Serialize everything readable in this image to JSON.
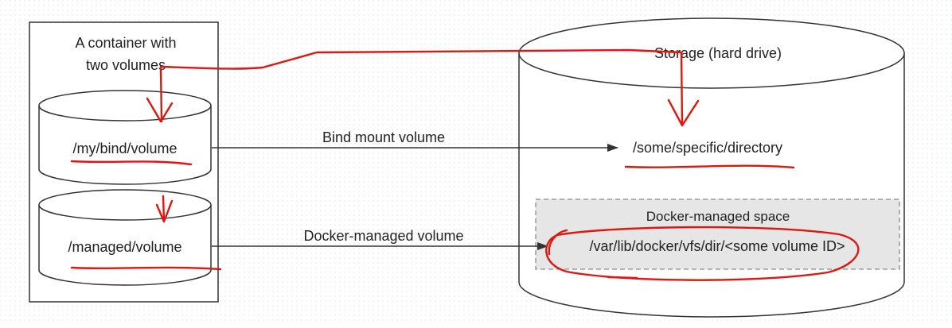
{
  "container": {
    "title_line1": "A container with",
    "title_line2": "two volumes",
    "bind_volume": "/my/bind/volume",
    "managed_volume": "/managed/volume"
  },
  "storage": {
    "title": "Storage (hard drive)",
    "specific_directory": "/some/specific/directory",
    "managed_space_title": "Docker-managed space",
    "managed_path": "/var/lib/docker/vfs/dir/<some volume ID>"
  },
  "arrows": {
    "bind_label": "Bind mount volume",
    "managed_label": "Docker-managed volume"
  },
  "colors": {
    "stroke": "#333333",
    "annotation": "#e0160f",
    "managed_space_fill": "#e6e6e6",
    "grid": "#dde3ea"
  }
}
